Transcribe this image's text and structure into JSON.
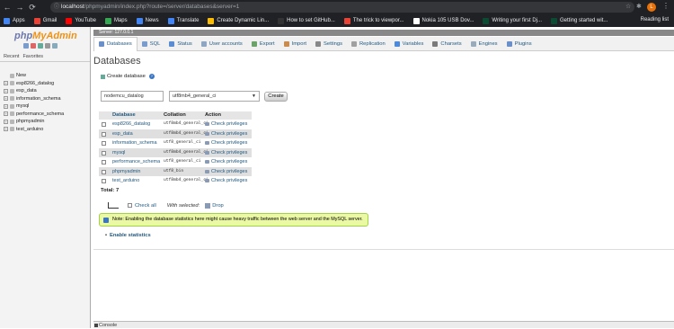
{
  "browser": {
    "url_host": "localhost",
    "url_path": "/phpmyadmin/index.php?route=/server/databases&server=1",
    "reading_list": "Reading list",
    "bookmarks": [
      {
        "label": "Apps",
        "color": "#4285f4"
      },
      {
        "label": "Gmail",
        "color": "#ea4335"
      },
      {
        "label": "YouTube",
        "color": "#ff0000"
      },
      {
        "label": "Maps",
        "color": "#34a853"
      },
      {
        "label": "News",
        "color": "#4285f4"
      },
      {
        "label": "Translate",
        "color": "#4285f4"
      },
      {
        "label": "Create Dynamic Lin...",
        "color": "#fbbc04"
      },
      {
        "label": "How to set GitHub...",
        "color": "#333333"
      },
      {
        "label": "The trick to viewpor...",
        "color": "#ea4335"
      },
      {
        "label": "Nokia 105 USB Dov...",
        "color": "#ffffff"
      },
      {
        "label": "Writing your first Dj...",
        "color": "#0c4b33"
      },
      {
        "label": "Getting started wit...",
        "color": "#0c4b33"
      }
    ],
    "profile_initial": "L"
  },
  "sidebar": {
    "logo_php": "php",
    "logo_my": "MyAdmin",
    "tabs": [
      "Recent",
      "Favorites"
    ],
    "items": [
      "New",
      "esp8266_datalog",
      "esp_data",
      "information_schema",
      "mysql",
      "performance_schema",
      "phpmyadmin",
      "test_arduino"
    ]
  },
  "breadcrumb": "Server: 127.0.0.1",
  "topmenu": [
    {
      "label": "Databases",
      "color": "#6b8fc7"
    },
    {
      "label": "SQL",
      "color": "#7a9ccd"
    },
    {
      "label": "Status",
      "color": "#5b8bd0"
    },
    {
      "label": "User accounts",
      "color": "#8fa6c2"
    },
    {
      "label": "Export",
      "color": "#6ba36b"
    },
    {
      "label": "Import",
      "color": "#c98b4f"
    },
    {
      "label": "Settings",
      "color": "#888888"
    },
    {
      "label": "Replication",
      "color": "#a0a0a0"
    },
    {
      "label": "Variables",
      "color": "#4a89dc"
    },
    {
      "label": "Charsets",
      "color": "#7a7a7a"
    },
    {
      "label": "Engines",
      "color": "#9ab"
    },
    {
      "label": "Plugins",
      "color": "#6b8fc7"
    }
  ],
  "main": {
    "title": "Databases",
    "create_title": "Create database",
    "db_name_value": "nodemcu_datalog",
    "collation_value": "utf8mb4_general_ci",
    "create_button": "Create",
    "headers": {
      "database": "Database",
      "collation": "Collation",
      "action": "Action"
    },
    "rows": [
      {
        "db": "esp8266_datalog",
        "coll": "utf8mb4_general_ci",
        "action": "Check privileges"
      },
      {
        "db": "esp_data",
        "coll": "utf8mb4_general_ci",
        "action": "Check privileges"
      },
      {
        "db": "information_schema",
        "coll": "utf8_general_ci",
        "action": "Check privileges"
      },
      {
        "db": "mysql",
        "coll": "utf8mb4_general_ci",
        "action": "Check privileges"
      },
      {
        "db": "performance_schema",
        "coll": "utf8_general_ci",
        "action": "Check privileges"
      },
      {
        "db": "phpmyadmin",
        "coll": "utf8_bin",
        "action": "Check privileges"
      },
      {
        "db": "test_arduino",
        "coll": "utf8mb4_general_ci",
        "action": "Check privileges"
      }
    ],
    "total": "Total: 7",
    "check_all": "Check all",
    "with_selected": "With selected:",
    "drop": "Drop",
    "note": "Note: Enabling the database statistics here might cause heavy traffic between the web server and the MySQL server.",
    "enable_stats": "Enable statistics"
  },
  "console": "Console"
}
